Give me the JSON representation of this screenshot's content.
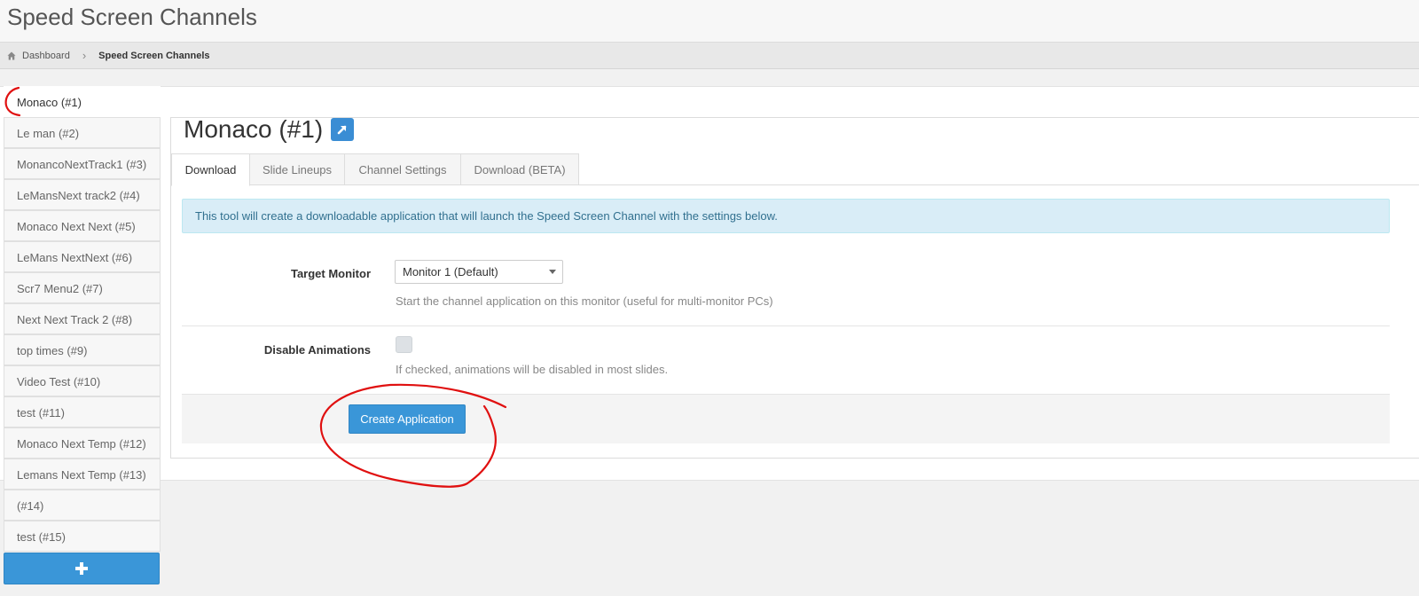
{
  "header": {
    "title": "Speed Screen Channels"
  },
  "breadcrumb": {
    "home_label": "Dashboard",
    "current_label": "Speed Screen Channels"
  },
  "sidebar": {
    "items": [
      {
        "label": "Monaco (#1)"
      },
      {
        "label": "Le man (#2)"
      },
      {
        "label": "MonancoNextTrack1 (#3)"
      },
      {
        "label": "LeMansNext track2 (#4)"
      },
      {
        "label": "Monaco Next Next (#5)"
      },
      {
        "label": "LeMans NextNext (#6)"
      },
      {
        "label": "Scr7 Menu2 (#7)"
      },
      {
        "label": "Next Next Track 2 (#8)"
      },
      {
        "label": "top times (#9)"
      },
      {
        "label": "Video Test (#10)"
      },
      {
        "label": "test (#11)"
      },
      {
        "label": "Monaco Next Temp (#12)"
      },
      {
        "label": "Lemans Next Temp (#13)"
      },
      {
        "label": "(#14)"
      },
      {
        "label": "test (#15)"
      }
    ],
    "add_icon": "plus-icon"
  },
  "main": {
    "channel_title": "Monaco (#1)",
    "external_icon": "external-link-icon",
    "tabs": [
      {
        "label": "Download"
      },
      {
        "label": "Slide Lineups"
      },
      {
        "label": "Channel Settings"
      },
      {
        "label": "Download (BETA)"
      }
    ],
    "info_text": "This tool will create a downloadable application that will launch the Speed Screen Channel with the settings below.",
    "target_monitor": {
      "label": "Target Monitor",
      "value": "Monitor 1 (Default)",
      "help": "Start the channel application on this monitor (useful for multi-monitor PCs)"
    },
    "disable_animations": {
      "label": "Disable Animations",
      "checked": false,
      "help": "If checked, animations will be disabled in most slides."
    },
    "create_label": "Create Application"
  },
  "colors": {
    "accent": "#3a96d8",
    "info_bg": "#d9edf7",
    "info_text": "#31708f",
    "annotation": "#e01010"
  }
}
